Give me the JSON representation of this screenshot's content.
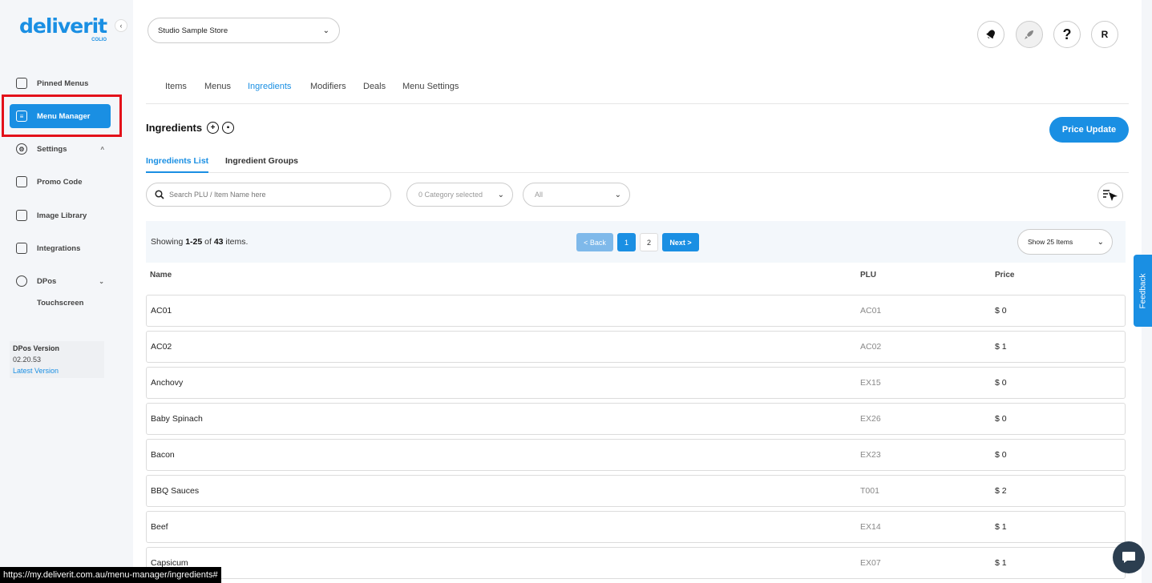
{
  "brand": {
    "name": "deliverit",
    "sub": "COLIO"
  },
  "sidebar": {
    "collapse_icon": "‹",
    "items": [
      {
        "label": "Pinned Menus"
      },
      {
        "label": "Menu Manager"
      },
      {
        "label": "Settings"
      },
      {
        "label": "Promo Code"
      },
      {
        "label": "Image Library"
      },
      {
        "label": "Integrations"
      },
      {
        "label": "DPos"
      }
    ],
    "sub_items": [
      {
        "label": "Touchscreen"
      }
    ],
    "version": {
      "title": "DPos Version",
      "number": "02.20.53",
      "link": "Latest Version"
    }
  },
  "header": {
    "store": "Studio Sample Store",
    "icons": [
      "bell-icon",
      "rocket-icon",
      "help-icon",
      "user-avatar"
    ],
    "help_label": "?",
    "avatar_label": "R"
  },
  "tabs": [
    {
      "label": "Items"
    },
    {
      "label": "Menus"
    },
    {
      "label": "Ingredients"
    },
    {
      "label": "Modifiers"
    },
    {
      "label": "Deals"
    },
    {
      "label": "Menu Settings"
    }
  ],
  "page": {
    "title": "Ingredients",
    "price_update": "Price Update",
    "subtabs": [
      {
        "label": "Ingredients List"
      },
      {
        "label": "Ingredient Groups"
      }
    ],
    "search_placeholder": "Search PLU / Item Name here",
    "category_filter": "0 Category selected",
    "status_filter": "All"
  },
  "pagination": {
    "showing_prefix": "Showing ",
    "range": "1-25",
    "of": " of ",
    "total": "43",
    "suffix": " items.",
    "back": "< Back",
    "pages": [
      "1",
      "2"
    ],
    "next": "Next >",
    "page_size": "Show 25 Items"
  },
  "table": {
    "columns": [
      "Name",
      "PLU",
      "Price"
    ],
    "rows": [
      {
        "name": "AC01",
        "plu": "AC01",
        "price": "$ 0"
      },
      {
        "name": "AC02",
        "plu": "AC02",
        "price": "$ 1"
      },
      {
        "name": "Anchovy",
        "plu": "EX15",
        "price": "$ 0"
      },
      {
        "name": "Baby Spinach",
        "plu": "EX26",
        "price": "$ 0"
      },
      {
        "name": "Bacon",
        "plu": "EX23",
        "price": "$ 0"
      },
      {
        "name": "BBQ Sauces",
        "plu": "T001",
        "price": "$ 2"
      },
      {
        "name": "Beef",
        "plu": "EX14",
        "price": "$ 1"
      },
      {
        "name": "Capsicum",
        "plu": "EX07",
        "price": "$ 1"
      }
    ]
  },
  "feedback": "Feedback",
  "status_url": "https://my.deliverit.com.au/menu-manager/ingredients#",
  "colors": {
    "accent": "#1a8fe3",
    "highlight": "#e3111a"
  }
}
